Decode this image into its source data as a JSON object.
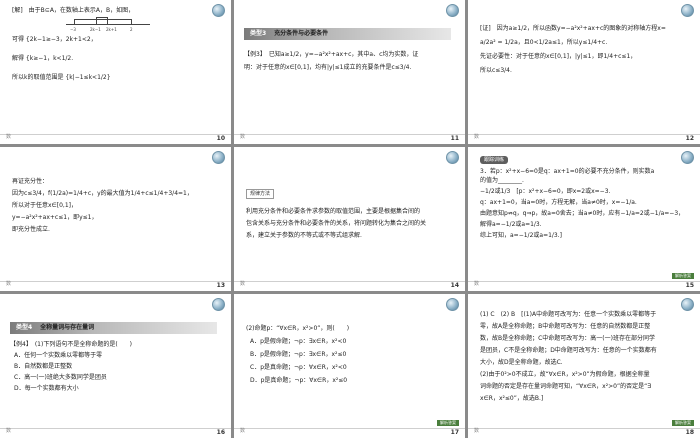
{
  "footer_mark": "数",
  "slides": [
    {
      "page": "10",
      "lines": [
        "[解]　由于B⊆A，在数轴上表示A，B，如图，",
        "可得 {2k−1≥−3，2k+1<2，",
        "解得 {k≥−1，k<1/2.",
        "所以k的取值范围是 {k|−1≤k<1/2}"
      ],
      "numline_labels": [
        "−3",
        "2k−1",
        "2k+1",
        "2"
      ]
    },
    {
      "page": "11",
      "banner_type": "类型3",
      "banner_title": "充分条件与必要条件",
      "lines": [
        "【例3】　已知a≥1/2，y=−a²x²+ax+c，其中a、c均为实数，证",
        "明：对于任意的x∈[0,1]，均有|y|≤1成立的充要条件是c≤3/4."
      ]
    },
    {
      "page": "12",
      "lines": [
        "[证]　因为a≥1/2，所以函数y=−a²x²+ax+c的图象的对称轴方程x=",
        "a/2a² = 1/2a，且0<1/2a≤1，所以y≤1/4+c.",
        "先证必要性：对于任意的x∈[0,1]，|y|≤1，即1/4+c≤1，",
        "所以c≤3/4."
      ]
    },
    {
      "page": "13",
      "lines": [
        "再证充分性：",
        "因为c≤3/4，f(1/2a)=1/4+c，y的最大值为1/4+c≤1/4+3/4=1，",
        "所以对于任意x∈[0,1]，",
        "y=−a²x²+ax+c≤1，即y≤1，",
        "即充分性成立."
      ]
    },
    {
      "page": "14",
      "tag": "规律方法",
      "lines": [
        "利用充分条件和必要条件求参数的取值范围，主要是根据集合间的",
        "包含关系与充分条件和必要条件的关系，将问题转化为集合之间的关",
        "系，建立关于参数的不等式或不等式组求解."
      ]
    },
    {
      "page": "15",
      "pill": "跟踪训练",
      "lines": [
        "3．若p：x²+x−6=0是q：ax+1=0的必要不充分条件，则实数a",
        "的值为________.",
        "−1/2或1/3　[p：x²+x−6=0，即x=2或x=−3.",
        "q：ax+1=0，当a=0时，方程无解，当a≠0时，x=−1/a.",
        "由题意知p⇏q，q⇒p，故a=0舍去；当a≠0时，应有−1/a=2或−1/a=−3，",
        "解得a=−1/2或a=1/3.",
        "综上可知，a=−1/2或a=1/3.]"
      ],
      "chip": "解析答案"
    },
    {
      "page": "16",
      "banner_type": "类型4",
      "banner_title": "全称量词与存在量词",
      "lines": [
        "【例4】　(1)下列语句不是全称命题的是(　　)",
        "A．任何一个实数乘以零都等于零",
        "B．自然数都是正整数",
        "C．高一(一)班绝大多数同学是团员",
        "D．每一个实数都有大小"
      ]
    },
    {
      "page": "17",
      "lines": [
        "(2)命题p：“∀x∈R，x²>0”，则(　　)",
        "A．p是假命题；¬p：∃x∈R，x²<0",
        "B．p是假命题；¬p：∃x∈R，x²≤0",
        "C．p是真命题；¬p：∀x∈R，x²<0",
        "D．p是真命题；¬p：∀x∈R，x²≤0"
      ],
      "chip": "解析答案"
    },
    {
      "page": "18",
      "lines": [
        "(1) C　(2) B　[(1)A中命题可改写为：任意一个实数乘以零都等于",
        "零，故A是全称命题；B中命题可改写为：任意的自然数都是正整",
        "数，故B是全称命题；C中命题可改写为：高一(一)班存在部分同学",
        "是团员，C不是全称命题；D中命题可改写为：任意的一个实数都有",
        "大小，故D是全称命题，故选C.",
        "(2)由于0²>0不成立，故“∀x∈R，x²>0”为假命题，根据全称量",
        "词命题的否定是存在量词命题可知，“∀x∈R，x²>0”的否定是“∃",
        "x∈R，x²≤0”，故选B.]"
      ],
      "chip": "解析答案"
    }
  ]
}
